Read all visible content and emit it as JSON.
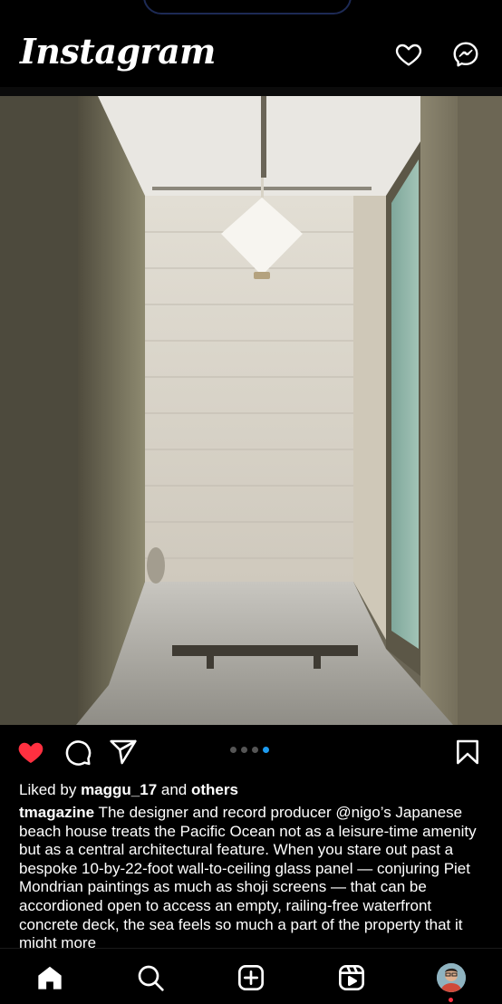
{
  "header": {
    "logo": "Instagram",
    "notifications_icon": "heart-outline-icon",
    "messages_icon": "messenger-icon"
  },
  "post": {
    "image_alt": "Concrete corridor with paper lantern and frosted glass panel",
    "carousel": {
      "count": 4,
      "active_index": 3
    },
    "liked": true,
    "likes_prefix": "Liked by",
    "liked_by_user": "maggu_17",
    "likes_and": "and",
    "likes_others": "others",
    "author": "tmagazine",
    "caption": " The designer and record producer @nigo’s Japanese beach house treats the Pacific Ocean not as a leisure-time amenity but as a central architectural feature. When you stare out past a bespoke 10-by-22-foot wall-to-ceiling glass panel — conjuring Piet Mondrian paintings as much as shoji screens — that can be accordioned open to access an empty, railing-free waterfront concrete deck, the sea feels so much a part of the property that it might more"
  },
  "tabbar": {
    "items": [
      "home-icon",
      "search-icon",
      "create-icon",
      "reels-icon",
      "profile-avatar"
    ]
  },
  "colors": {
    "like_red": "#ff3040",
    "active_dot": "#1d9bf0",
    "background": "#000000"
  }
}
